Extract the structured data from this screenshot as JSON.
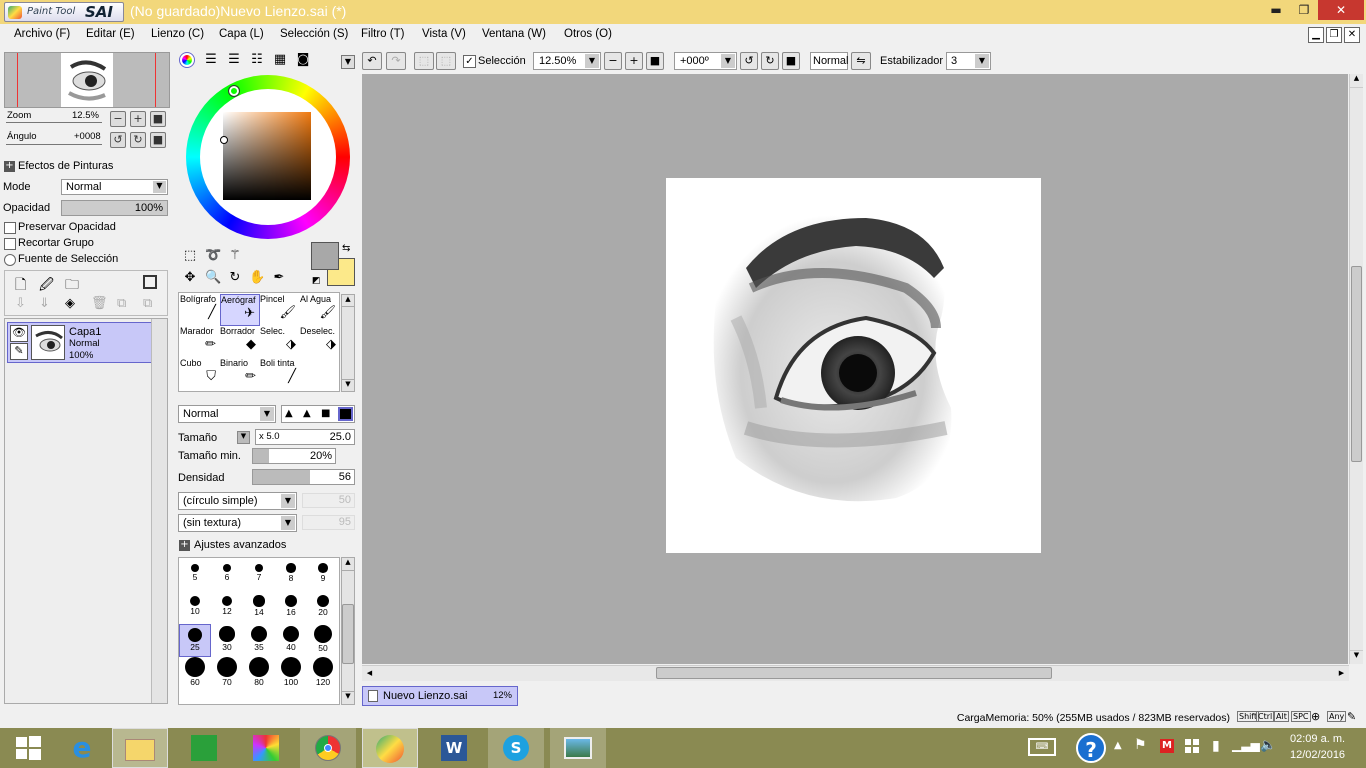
{
  "app": {
    "title": "(No guardado)Nuevo Lienzo.sai (*)",
    "logo_small": "Paint Tool",
    "logo_big": "SAI"
  },
  "window_buttons": {
    "minimize": "▬",
    "restore": "❐",
    "close": "✕"
  },
  "menu": [
    "Archivo (F)",
    "Editar (E)",
    "Lienzo (C)",
    "Capa (L)",
    "Selección (S)",
    "Filtro (T)",
    "Vista (V)",
    "Ventana (W)",
    "Otros (O)"
  ],
  "navigator": {
    "zoom_label": "Zoom",
    "zoom_value": "12.5%",
    "angle_label": "Ángulo",
    "angle_value": "+0008"
  },
  "layer_panel": {
    "effects_label": "Efectos de Pinturas",
    "mode_label": "Mode",
    "mode_value": "Normal",
    "opacity_label": "Opacidad",
    "opacity_value": "100%",
    "preserve_opacity": "Preservar Opacidad",
    "clip_group": "Recortar Grupo",
    "selection_source": "Fuente de Selección",
    "layers": [
      {
        "name": "Capa1",
        "mode": "Normal",
        "opacity": "100%"
      }
    ]
  },
  "toolbar": {
    "selection_label": "Selección",
    "zoom_value": "12.50%",
    "angle_value": "+000º",
    "blend_value": "Normal",
    "stabilizer_label": "Estabilizador",
    "stabilizer_value": "3"
  },
  "brushes": [
    {
      "name": "Bolígrafo"
    },
    {
      "name": "Aerógraf"
    },
    {
      "name": "Pincel"
    },
    {
      "name": "Al Agua"
    },
    {
      "name": "Marador"
    },
    {
      "name": "Borrador"
    },
    {
      "name": "Selec."
    },
    {
      "name": "Deselec."
    },
    {
      "name": "Cubo"
    },
    {
      "name": "Binario"
    },
    {
      "name": "Boli tinta"
    }
  ],
  "brush_settings": {
    "blend_mode": "Normal",
    "size_label": "Tamaño",
    "size_mult": "x 5.0",
    "size_value": "25.0",
    "min_size_label": "Tamaño min.",
    "min_size_value": "20%",
    "min_size_fraction": 0.2,
    "density_label": "Densidad",
    "density_value": "56",
    "density_fraction": 0.56,
    "shape": "(círculo simple)",
    "shape_value": "50",
    "texture": "(sin textura)",
    "texture_value": "95",
    "advanced_label": "Ajustes avanzados"
  },
  "brush_sizes": [
    "5",
    "6",
    "7",
    "8",
    "9",
    "10",
    "12",
    "14",
    "16",
    "20",
    "25",
    "30",
    "35",
    "40",
    "50",
    "60",
    "70",
    "80",
    "100",
    "120"
  ],
  "selected_brush_size": "25",
  "canvas_tab": {
    "name": "Nuevo Lienzo.sai",
    "zoom": "12%"
  },
  "status": {
    "memory": "CargaMemoria: 50% (255MB usados / 823MB reservados)",
    "keys": [
      "Shift",
      "Ctrl",
      "Alt",
      "SPC",
      "Any"
    ]
  },
  "colors": {
    "primary": "#a8a8a8",
    "secondary": "#fce98a",
    "accent": "#c8c8f8",
    "titlebar": "#f2d77b"
  },
  "taskbar": {
    "apps": [
      "windows-start-icon",
      "internet-explorer-icon",
      "file-explorer-icon",
      "store-icon",
      "paint-app-icon",
      "chrome-icon",
      "paint-tool-sai-icon",
      "word-icon",
      "skype-icon",
      "photos-icon"
    ],
    "time": "02:09 a. m.",
    "date": "12/02/2016"
  }
}
